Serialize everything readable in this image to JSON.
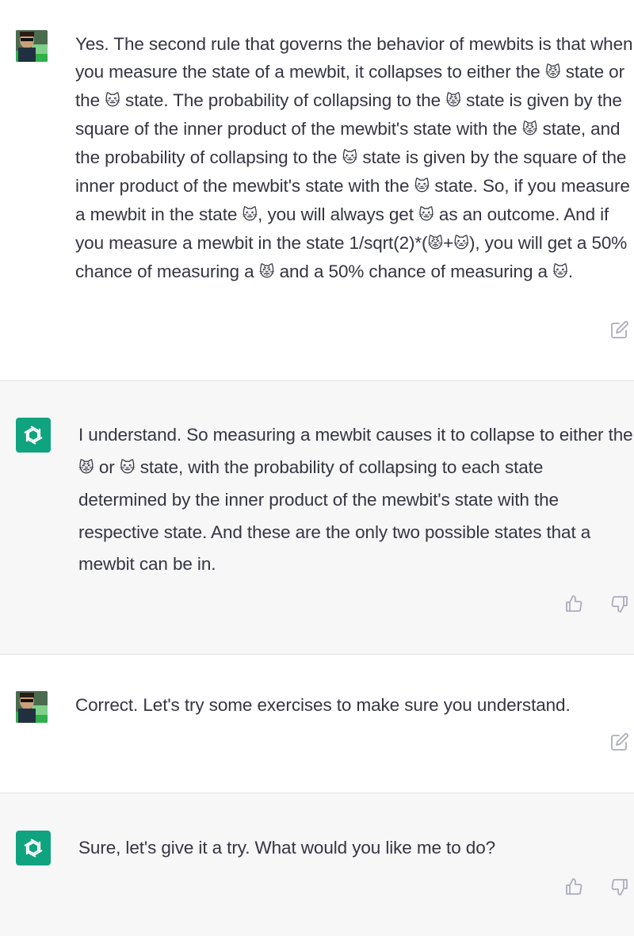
{
  "messages": [
    {
      "role": "user",
      "parts": [
        "Yes. The second rule that governs the behavior of mewbits is that when you measure the state of a mewbit, it collapses to either the ",
        "😾",
        " state or the ",
        "🐱",
        " state. The probability of collapsing to the ",
        "😾",
        " state is given by the square of the inner product of the mewbit's state with the ",
        "😾",
        " state, and the probability of collapsing to the ",
        "🐱",
        " state is given by the square of the inner product of the mewbit's state with the ",
        "🐱",
        " state. So, if you measure a mewbit in the state ",
        "🐱",
        ", you will always get ",
        "🐱",
        " as an outcome. And if you measure a mewbit in the state 1/sqrt(2)*(",
        "😾",
        "+",
        "🐱",
        "), you will get a 50% chance of measuring a ",
        "😾",
        " and a 50% chance of measuring a ",
        "🐱",
        "."
      ],
      "actions": [
        "edit-icon"
      ]
    },
    {
      "role": "assistant",
      "parts": [
        "I understand. So measuring a mewbit causes it to collapse to either the ",
        "😾",
        " or ",
        "🐱",
        " state, with the probability of collapsing to each state determined by the inner product of the mewbit's state with the respective state. And these are the only two possible states that a mewbit can be in."
      ],
      "actions": [
        "thumbs-up-icon",
        "thumbs-down-icon"
      ]
    },
    {
      "role": "user",
      "parts": [
        "Correct. Let's try some exercises to make sure you understand."
      ],
      "actions": [
        "edit-icon"
      ]
    },
    {
      "role": "assistant",
      "parts": [
        "Sure, let's give it a try. What would you like me to do?"
      ],
      "actions": [
        "thumbs-up-icon",
        "thumbs-down-icon"
      ]
    }
  ],
  "colors": {
    "assistant_bg": "#f7f7f8",
    "bot_avatar": "#10a37f",
    "text": "#343541",
    "icon": "#acacbe"
  }
}
